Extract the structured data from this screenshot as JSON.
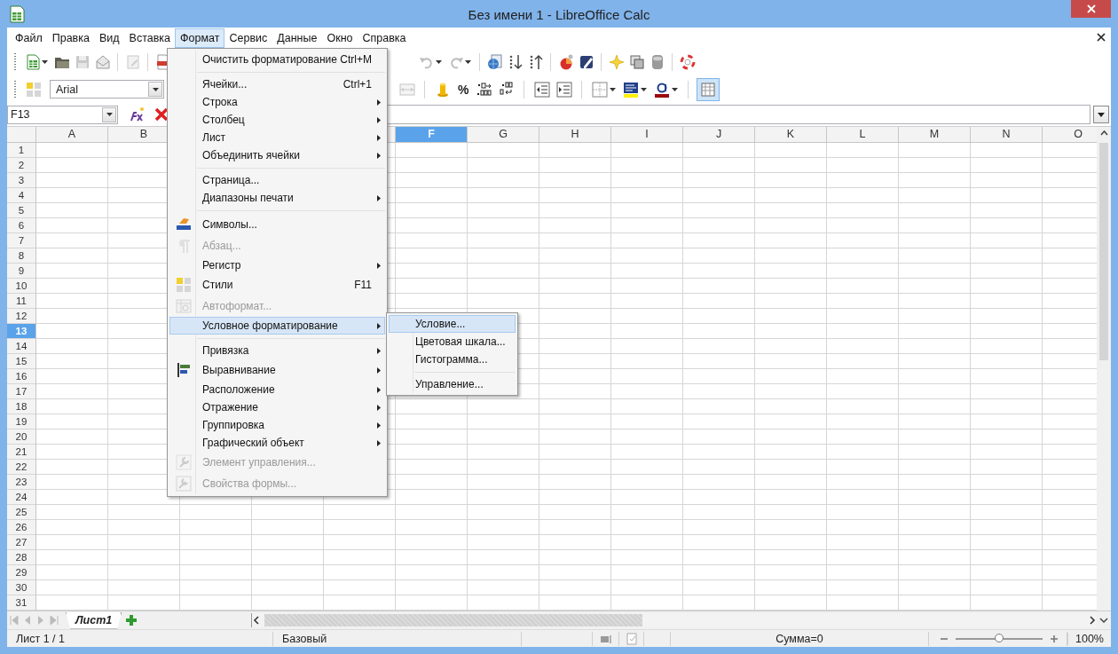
{
  "window": {
    "title": "Без имени 1 - LibreOffice Calc"
  },
  "menubar": [
    {
      "label": "Файл",
      "selected": false
    },
    {
      "label": "Правка",
      "selected": false
    },
    {
      "label": "Вид",
      "selected": false
    },
    {
      "label": "Вставка",
      "selected": false
    },
    {
      "label": "Формат",
      "selected": true
    },
    {
      "label": "Сервис",
      "selected": false
    },
    {
      "label": "Данные",
      "selected": false
    },
    {
      "label": "Окно",
      "selected": false
    },
    {
      "label": "Справка",
      "selected": false
    }
  ],
  "formatting_toolbar": {
    "font_name": "Arial",
    "percent_button": "%",
    "grid_lines_on": true
  },
  "formula_bar": {
    "name_box": "F13"
  },
  "sheet": {
    "columns": [
      {
        "label": "A",
        "selected": false
      },
      {
        "label": "B",
        "selected": false
      },
      {
        "label": "F",
        "selected": true
      },
      {
        "label": "G",
        "selected": false
      },
      {
        "label": "H",
        "selected": false
      },
      {
        "label": "I",
        "selected": false
      },
      {
        "label": "J",
        "selected": false
      },
      {
        "label": "K",
        "selected": false
      },
      {
        "label": "L",
        "selected": false
      },
      {
        "label": "M",
        "selected": false
      },
      {
        "label": "N",
        "selected": false
      },
      {
        "label": "O",
        "selected": false
      }
    ],
    "rows": [
      {
        "label": "1",
        "selected": false
      },
      {
        "label": "2",
        "selected": false
      },
      {
        "label": "3",
        "selected": false
      },
      {
        "label": "4",
        "selected": false
      },
      {
        "label": "5",
        "selected": false
      },
      {
        "label": "6",
        "selected": false
      },
      {
        "label": "7",
        "selected": false
      },
      {
        "label": "8",
        "selected": false
      },
      {
        "label": "9",
        "selected": false
      },
      {
        "label": "10",
        "selected": false
      },
      {
        "label": "11",
        "selected": false
      },
      {
        "label": "12",
        "selected": false
      },
      {
        "label": "13",
        "selected": true
      },
      {
        "label": "14",
        "selected": false
      },
      {
        "label": "15",
        "selected": false
      },
      {
        "label": "16",
        "selected": false
      },
      {
        "label": "17",
        "selected": false
      },
      {
        "label": "18",
        "selected": false
      },
      {
        "label": "19",
        "selected": false
      },
      {
        "label": "20",
        "selected": false
      },
      {
        "label": "21",
        "selected": false
      },
      {
        "label": "22",
        "selected": false
      },
      {
        "label": "23",
        "selected": false
      },
      {
        "label": "24",
        "selected": false
      },
      {
        "label": "25",
        "selected": false
      },
      {
        "label": "26",
        "selected": false
      },
      {
        "label": "27",
        "selected": false
      },
      {
        "label": "28",
        "selected": false
      },
      {
        "label": "29",
        "selected": false
      },
      {
        "label": "30",
        "selected": false
      },
      {
        "label": "31",
        "selected": false
      }
    ]
  },
  "format_menu": [
    {
      "kind": "item",
      "label": "Очистить форматирование",
      "shortcut": "Ctrl+M",
      "submenu": false,
      "disabled": false,
      "selected": false
    },
    {
      "kind": "separator"
    },
    {
      "kind": "item",
      "label": "Ячейки...",
      "shortcut": "Ctrl+1",
      "submenu": false,
      "disabled": false,
      "selected": false
    },
    {
      "kind": "item",
      "label": "Строка",
      "submenu": true,
      "disabled": false,
      "selected": false
    },
    {
      "kind": "item",
      "label": "Столбец",
      "submenu": true,
      "disabled": false,
      "selected": false
    },
    {
      "kind": "item",
      "label": "Лист",
      "submenu": true,
      "disabled": false,
      "selected": false
    },
    {
      "kind": "item",
      "label": "Объединить ячейки",
      "submenu": true,
      "disabled": false,
      "selected": false
    },
    {
      "kind": "separator"
    },
    {
      "kind": "item",
      "label": "Страница...",
      "submenu": false,
      "disabled": false,
      "selected": false
    },
    {
      "kind": "item",
      "label": "Диапазоны печати",
      "submenu": true,
      "disabled": false,
      "selected": false
    },
    {
      "kind": "separator"
    },
    {
      "kind": "item",
      "label": "Символы...",
      "submenu": false,
      "disabled": false,
      "selected": false
    },
    {
      "kind": "item",
      "label": "Абзац...",
      "submenu": false,
      "disabled": true,
      "selected": false
    },
    {
      "kind": "item",
      "label": "Регистр",
      "submenu": true,
      "disabled": false,
      "selected": false
    },
    {
      "kind": "item",
      "label": "Стили",
      "shortcut": "F11",
      "submenu": false,
      "disabled": false,
      "selected": false
    },
    {
      "kind": "item",
      "label": "Автоформат...",
      "submenu": false,
      "disabled": true,
      "selected": false
    },
    {
      "kind": "item",
      "label": "Условное форматирование",
      "submenu": true,
      "disabled": false,
      "selected": true
    },
    {
      "kind": "separator"
    },
    {
      "kind": "item",
      "label": "Привязка",
      "submenu": true,
      "disabled": false,
      "selected": false
    },
    {
      "kind": "item",
      "label": "Выравнивание",
      "submenu": true,
      "disabled": false,
      "selected": false
    },
    {
      "kind": "item",
      "label": "Расположение",
      "submenu": true,
      "disabled": false,
      "selected": false
    },
    {
      "kind": "item",
      "label": "Отражение",
      "submenu": true,
      "disabled": false,
      "selected": false
    },
    {
      "kind": "item",
      "label": "Группировка",
      "submenu": true,
      "disabled": false,
      "selected": false
    },
    {
      "kind": "item",
      "label": "Графический объект",
      "submenu": true,
      "disabled": false,
      "selected": false
    },
    {
      "kind": "item",
      "label": "Элемент управления...",
      "submenu": false,
      "disabled": true,
      "selected": false
    },
    {
      "kind": "item",
      "label": "Свойства формы...",
      "submenu": false,
      "disabled": true,
      "selected": false
    }
  ],
  "conditional_submenu": [
    {
      "kind": "item",
      "label": "Условие...",
      "submenu": false,
      "disabled": false,
      "selected": true
    },
    {
      "kind": "item",
      "label": "Цветовая шкала...",
      "submenu": false,
      "disabled": false,
      "selected": false
    },
    {
      "kind": "item",
      "label": "Гистограмма...",
      "submenu": false,
      "disabled": false,
      "selected": false
    },
    {
      "kind": "separator"
    },
    {
      "kind": "item",
      "label": "Управление...",
      "submenu": false,
      "disabled": false,
      "selected": false
    }
  ],
  "sheet_tabs": [
    {
      "label": "Лист1",
      "selected": true
    }
  ],
  "status_bar": {
    "sheet": "Лист 1 / 1",
    "page_style": "Базовый",
    "sum": "Сумма=0",
    "zoom": {
      "level": 0.5
    },
    "zoom_percent": "100%"
  }
}
